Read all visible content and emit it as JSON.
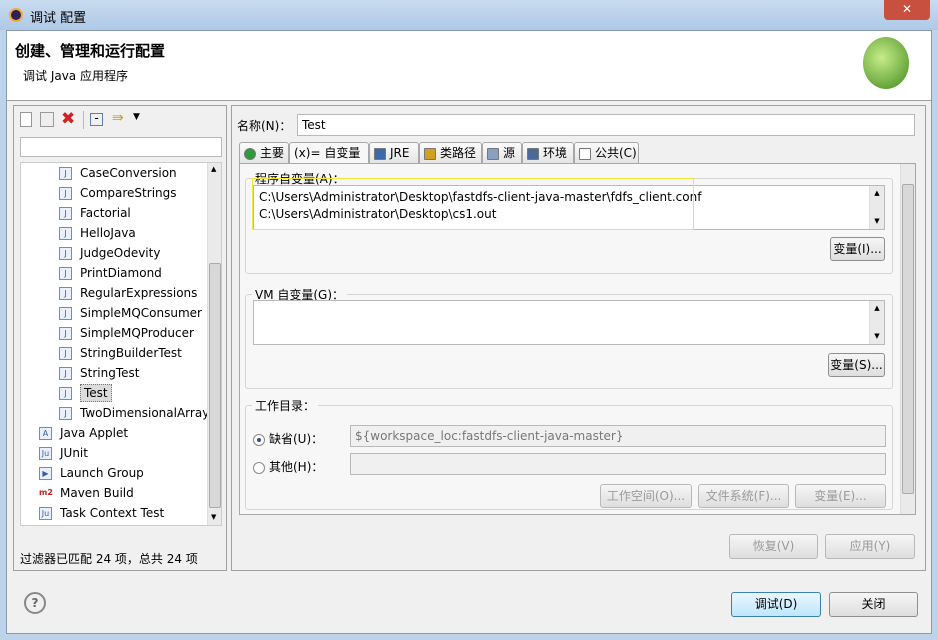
{
  "window": {
    "title": "调试 配置"
  },
  "header": {
    "title": "创建、管理和运行配置",
    "subtitle": "调试 Java 应用程序",
    "bug_icon": "bug-icon"
  },
  "left": {
    "toolbar": [
      "new-config-icon",
      "duplicate-icon",
      "delete-icon",
      "collapse-all-icon",
      "filter-icon",
      "dropdown-arrow-icon"
    ],
    "filter_value": "",
    "tree": [
      {
        "label": "CaseConversion",
        "level": 2,
        "icon": "java-class-icon"
      },
      {
        "label": "CompareStrings",
        "level": 2,
        "icon": "java-class-icon"
      },
      {
        "label": "Factorial",
        "level": 2,
        "icon": "java-class-icon"
      },
      {
        "label": "HelloJava",
        "level": 2,
        "icon": "java-class-icon"
      },
      {
        "label": "JudgeOdevity",
        "level": 2,
        "icon": "java-class-icon"
      },
      {
        "label": "PrintDiamond",
        "level": 2,
        "icon": "java-class-icon"
      },
      {
        "label": "RegularExpressions",
        "level": 2,
        "icon": "java-class-icon"
      },
      {
        "label": "SimpleMQConsumer",
        "level": 2,
        "icon": "java-class-icon"
      },
      {
        "label": "SimpleMQProducer",
        "level": 2,
        "icon": "java-class-icon"
      },
      {
        "label": "StringBuilderTest",
        "level": 2,
        "icon": "java-class-icon"
      },
      {
        "label": "StringTest",
        "level": 2,
        "icon": "java-class-icon"
      },
      {
        "label": "Test",
        "level": 2,
        "icon": "java-class-icon",
        "selected": true
      },
      {
        "label": "TwoDimensionalArray",
        "level": 2,
        "icon": "java-class-icon"
      },
      {
        "label": "Java Applet",
        "level": 1,
        "icon": "java-applet-icon"
      },
      {
        "label": "JUnit",
        "level": 1,
        "icon": "junit-icon"
      },
      {
        "label": "Launch Group",
        "level": 1,
        "icon": "launch-group-icon"
      },
      {
        "label": "Maven Build",
        "level": 1,
        "icon": "maven-icon"
      },
      {
        "label": "Task Context Test",
        "level": 1,
        "icon": "task-context-icon"
      }
    ],
    "status": "过滤器已匹配 24 项，总共 24 项"
  },
  "right": {
    "name_label": "名称(N)：",
    "name_value": "Test",
    "tabs": [
      {
        "label": "主要"
      },
      {
        "label": "(x)= 自变量",
        "active": true
      },
      {
        "label": "JRE"
      },
      {
        "label": "类路径"
      },
      {
        "label": "源"
      },
      {
        "label": "环境"
      },
      {
        "label": "公共(C)"
      }
    ],
    "program_args": {
      "label": "程序自变量(A)：",
      "lines": [
        "C:\\Users\\Administrator\\Desktop\\fastdfs-client-java-master\\fdfs_client.conf",
        "C:\\Users\\Administrator\\Desktop\\cs1.out"
      ],
      "button": "变量(I)..."
    },
    "vm_args": {
      "label": "VM 自变量(G)：",
      "value": "",
      "button": "变量(S)..."
    },
    "workdir": {
      "label": "工作目录：",
      "default_label": "缺省(U)：",
      "default_value": "${workspace_loc:fastdfs-client-java-master}",
      "other_label": "其他(H)：",
      "other_value": "",
      "buttons": [
        "工作空间(O)...",
        "文件系统(F)...",
        "变量(E)..."
      ]
    },
    "revert": "恢复(V)",
    "apply": "应用(Y)"
  },
  "footer": {
    "debug": "调试(D)",
    "close": "关闭"
  },
  "colors": {
    "highlight": "#f5f07a",
    "selection": "#dcdcdc"
  }
}
